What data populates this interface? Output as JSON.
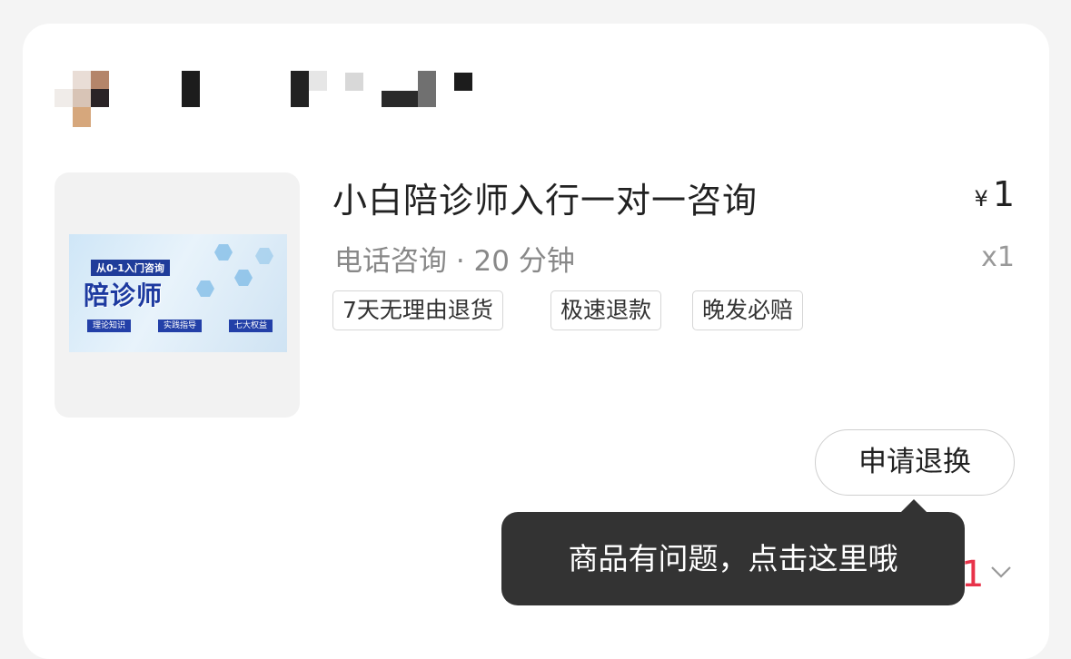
{
  "product": {
    "title": "小白陪诊师入行一对一咨询",
    "currency": "¥",
    "price": "1",
    "subtitle": "电话咨询 · 20 分钟",
    "quantity": "x1",
    "image": {
      "banner_top": "从0-1入门咨询",
      "banner_main": "陪诊师",
      "banner_chips": [
        "理论知识",
        "实践指导",
        "七大权益"
      ]
    }
  },
  "tags": [
    "7天无理由退货",
    "极速退款",
    "晚发必赔"
  ],
  "actions": {
    "refund_button": "申请退换"
  },
  "tooltip": {
    "text": "商品有问题，点击这里哦"
  },
  "partial_text": "1",
  "icons": {
    "dropdown": "chevron-down-icon"
  },
  "colors": {
    "tooltip_bg": "#333333",
    "accent_red": "#e8334a",
    "banner_blue": "#1d3aa0"
  }
}
